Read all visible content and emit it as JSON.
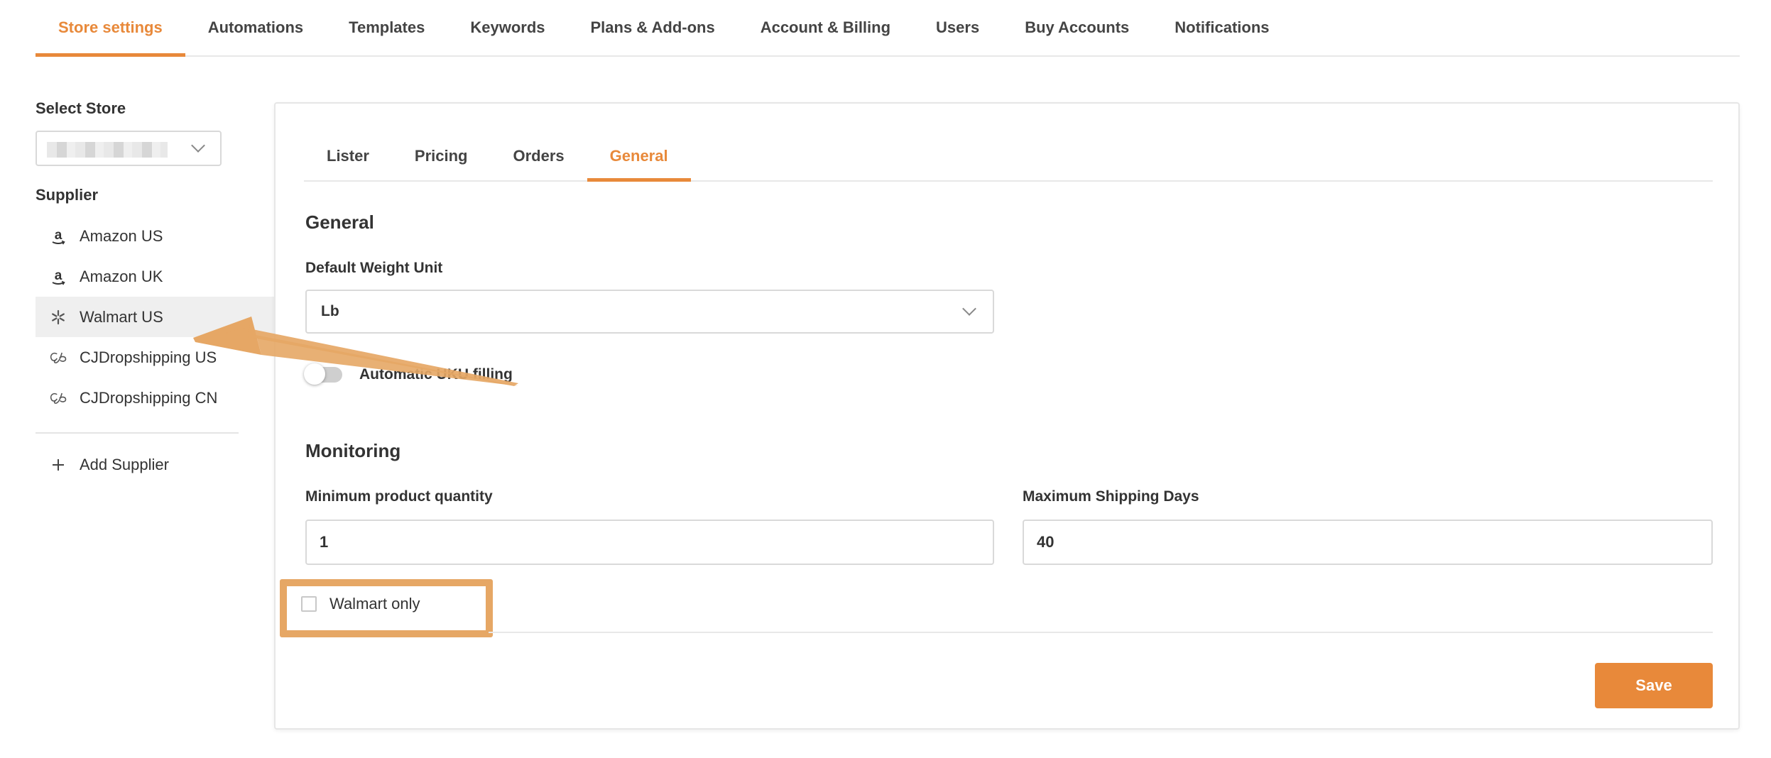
{
  "top_nav": {
    "tabs": [
      {
        "label": "Store settings"
      },
      {
        "label": "Automations"
      },
      {
        "label": "Templates"
      },
      {
        "label": "Keywords"
      },
      {
        "label": "Plans & Add-ons"
      },
      {
        "label": "Account & Billing"
      },
      {
        "label": "Users"
      },
      {
        "label": "Buy Accounts"
      },
      {
        "label": "Notifications"
      }
    ],
    "active_tab": "Store settings"
  },
  "sidebar": {
    "select_store_label": "Select Store",
    "supplier_label": "Supplier",
    "suppliers": [
      {
        "label": "Amazon US",
        "icon": "amazon-icon"
      },
      {
        "label": "Amazon UK",
        "icon": "amazon-icon"
      },
      {
        "label": "Walmart US",
        "icon": "walmart-spark-icon"
      },
      {
        "label": "CJDropshipping US",
        "icon": "cjdropshipping-icon"
      },
      {
        "label": "CJDropshipping CN",
        "icon": "cjdropshipping-icon"
      }
    ],
    "active_supplier": "Walmart US",
    "add_supplier_label": "Add Supplier"
  },
  "main": {
    "tabs": [
      {
        "label": "Lister"
      },
      {
        "label": "Pricing"
      },
      {
        "label": "Orders"
      },
      {
        "label": "General"
      }
    ],
    "active_tab": "General",
    "general": {
      "title": "General",
      "weight_unit_label": "Default Weight Unit",
      "weight_unit_value": "Lb",
      "toggle_label": "Automatic UKU filling",
      "toggle_on": false
    },
    "monitoring": {
      "title": "Monitoring",
      "min_qty_label": "Minimum product quantity",
      "min_qty_value": "1",
      "max_days_label": "Maximum Shipping Days",
      "max_days_value": "40",
      "walmart_only_label": "Walmart only",
      "walmart_only_checked": false
    },
    "save_label": "Save"
  },
  "colors": {
    "accent": "#e8893a",
    "annotation": "#e6a765",
    "active_bg": "#efefef"
  }
}
